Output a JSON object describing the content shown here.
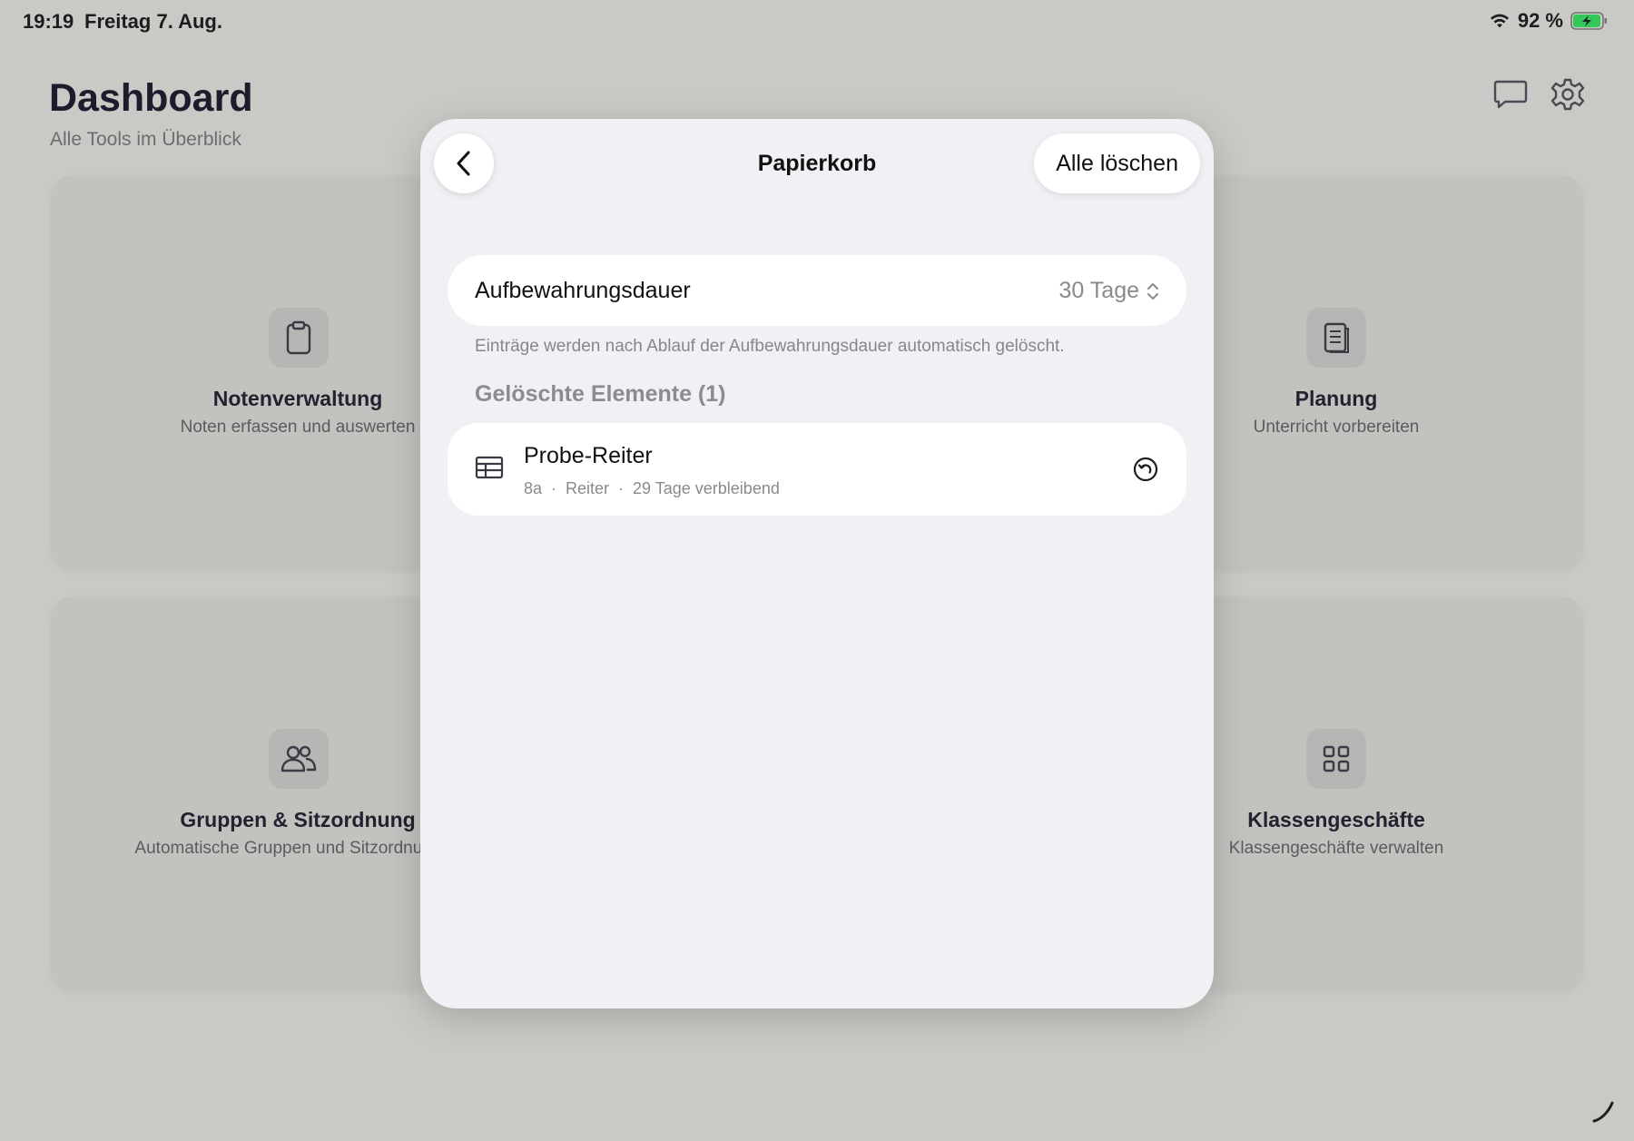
{
  "status": {
    "time": "19:19",
    "date": "Freitag 7. Aug.",
    "battery": "92 %"
  },
  "header": {
    "title": "Dashboard",
    "subtitle": "Alle Tools im Überblick",
    "icons": [
      "chat-bubble-icon",
      "gear-icon"
    ]
  },
  "cards": [
    {
      "title": "Notenverwaltung",
      "subtitle": "Noten erfassen und auswerten",
      "icon": "clipboard-icon"
    },
    {
      "title": "Planung",
      "subtitle": "Unterricht vorbereiten",
      "icon": "document-icon"
    },
    {
      "title": "Gruppen & Sitzordnung",
      "subtitle": "Automatische Gruppen und Sitzordnungen",
      "icon": "people-icon"
    },
    {
      "title": "Klassengeschäfte",
      "subtitle": "Klassengeschäfte verwalten",
      "icon": "grid-icon"
    }
  ],
  "modal": {
    "title": "Papierkorb",
    "clear_all": "Alle löschen",
    "retention": {
      "label": "Aufbewahrungsdauer",
      "value": "30 Tage",
      "note": "Einträge werden nach Ablauf der Aufbewahrungsdauer automatisch gelöscht."
    },
    "section_title": "Gelöschte Elemente (1)",
    "items": [
      {
        "title": "Probe-Reiter",
        "class": "8a",
        "type": "Reiter",
        "remaining": "29 Tage verbleibend",
        "icon": "table-icon"
      }
    ]
  },
  "colors": {
    "backdrop": "#c9c9c6",
    "modal_bg": "#f1f1f5",
    "battery_green": "#34c759"
  }
}
